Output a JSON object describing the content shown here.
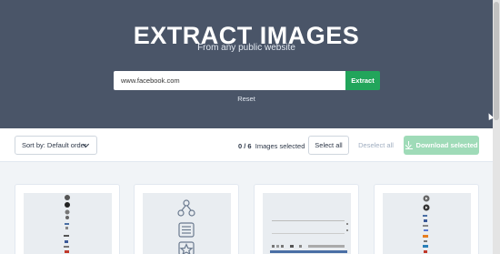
{
  "hero": {
    "title": "EXTRACT IMAGES",
    "subtitle": "From any public website",
    "url_value": "www.facebook.com",
    "extract_label": "Extract",
    "reset_label": "Reset"
  },
  "toolbar": {
    "sort_label": "Sort by: Default order",
    "selected_count": "0 / 6",
    "selected_text": "Images selected",
    "select_all_label": "Select all",
    "deselect_all_label": "Deselect all",
    "download_label": "Download selected"
  },
  "colors": {
    "hero_bg": "#4a5568",
    "accent_green": "#22a55b",
    "download_disabled": "#9fdbb8"
  },
  "cards": [
    {
      "icon": "sprite-sheet-thumbnail"
    },
    {
      "icon": "share-list-star-icons-thumbnail"
    },
    {
      "icon": "toolbar-sprite-thumbnail"
    },
    {
      "icon": "play-icons-sprite-thumbnail"
    }
  ]
}
